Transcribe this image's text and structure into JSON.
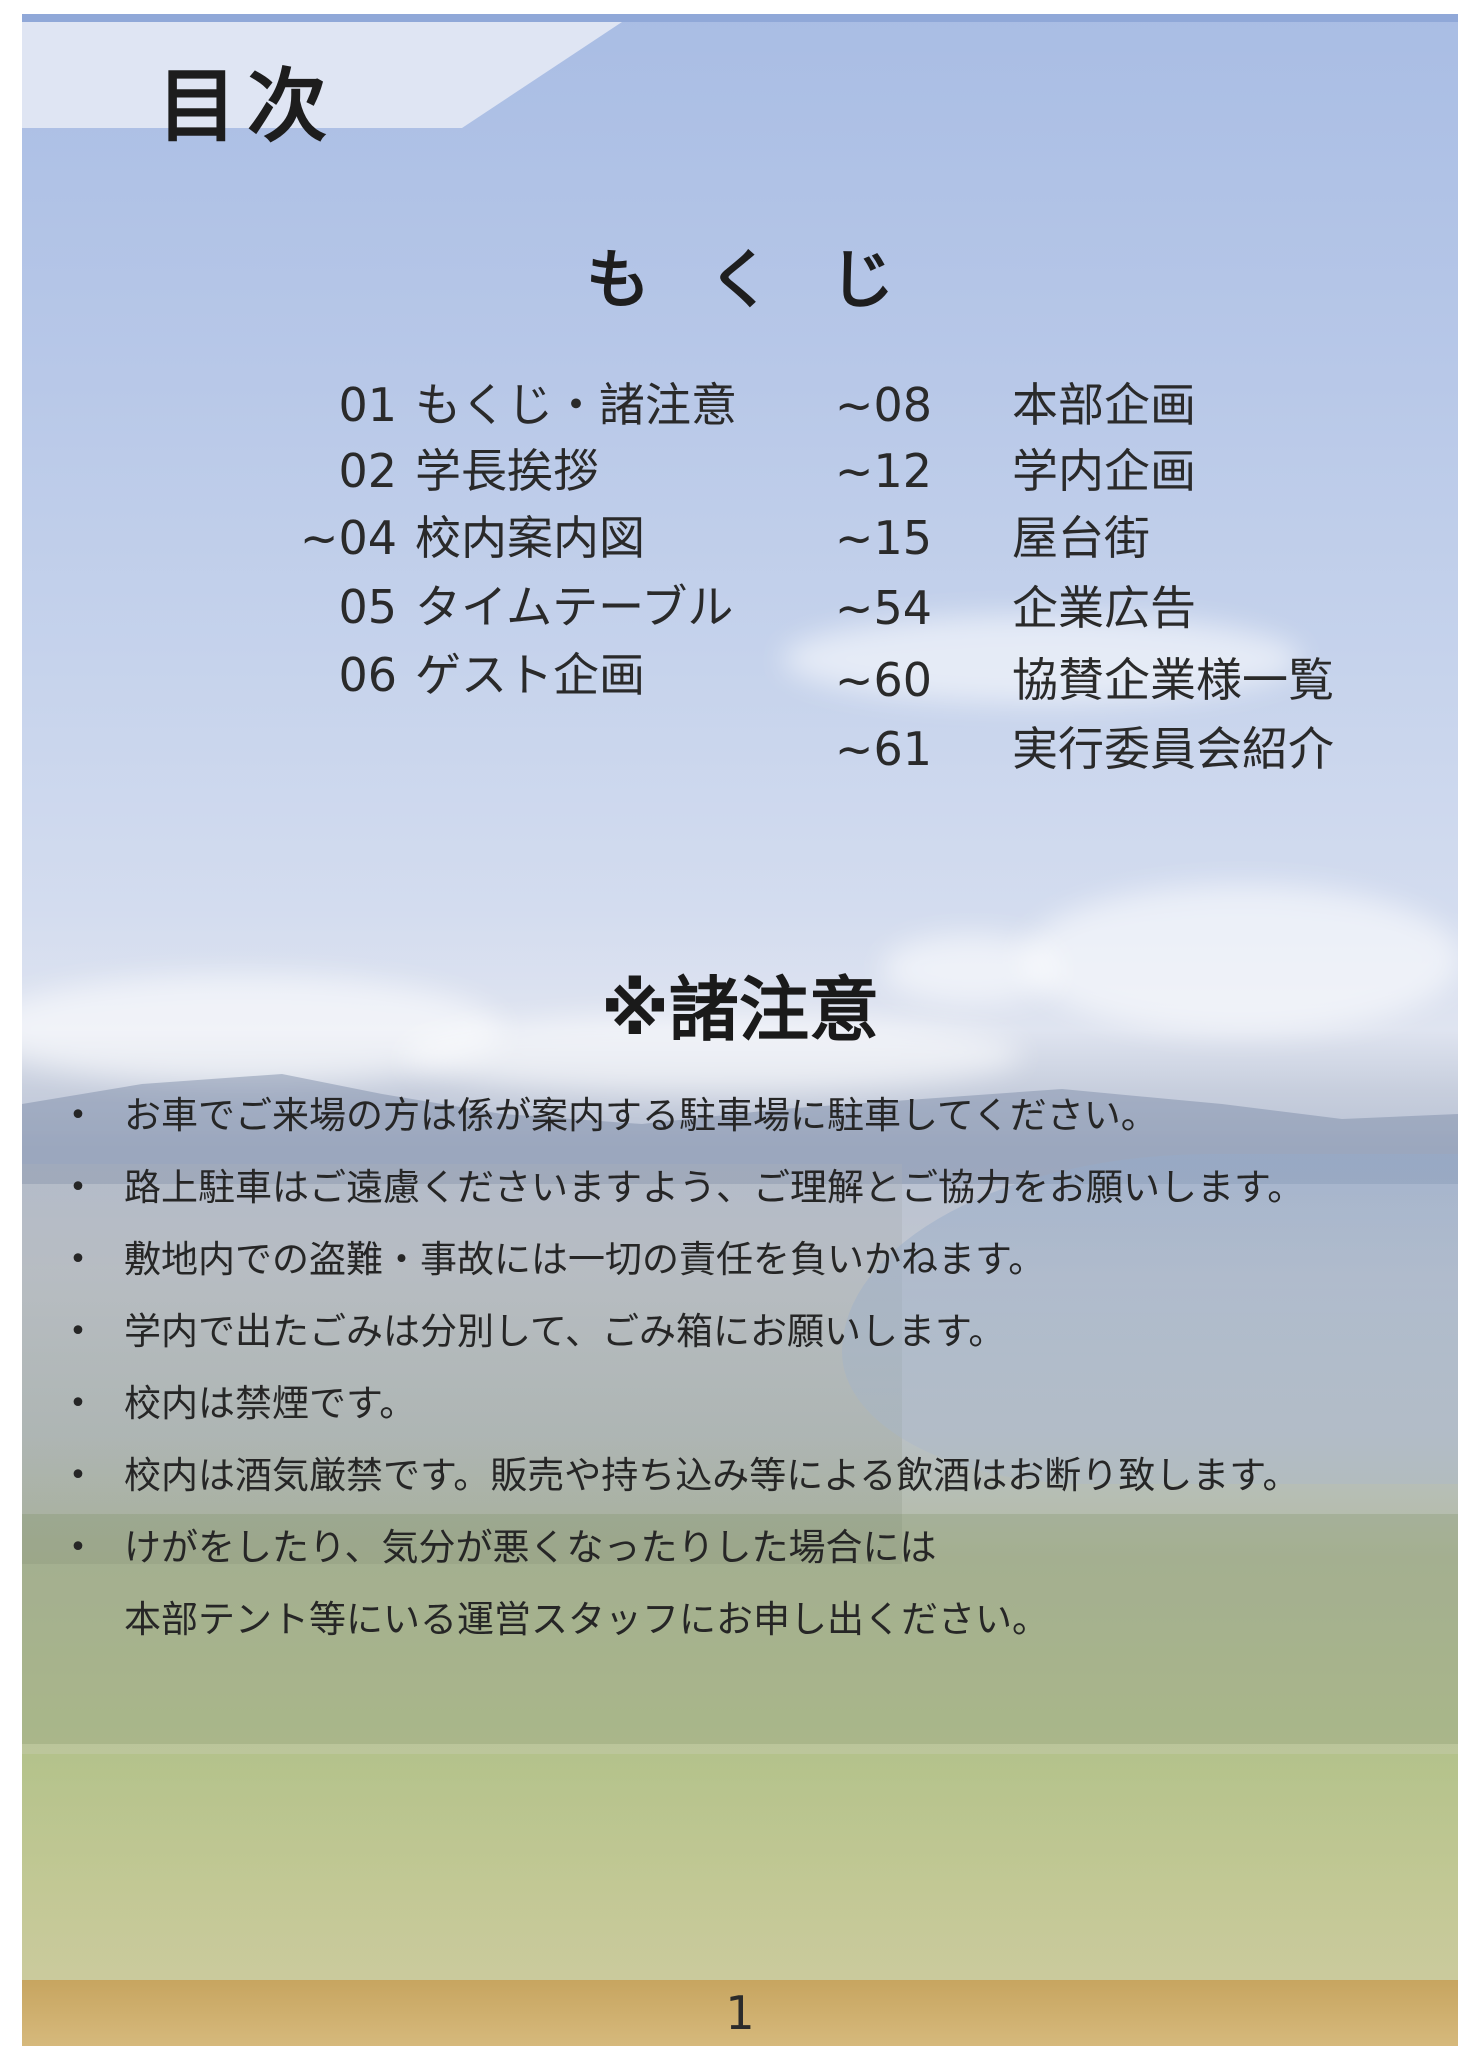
{
  "header": {
    "title": "目次"
  },
  "toc": {
    "heading": "もくじ",
    "left": [
      {
        "num": "01",
        "title": "もくじ・諸注意"
      },
      {
        "num": "02",
        "title": "学長挨拶"
      },
      {
        "num": "~04",
        "title": " 校内案内図"
      },
      {
        "num": "05",
        "title": "タイムテーブル"
      },
      {
        "num": "06",
        "title": "ゲスト企画"
      }
    ],
    "right": [
      {
        "num": "~08",
        "title": "本部企画"
      },
      {
        "num": "~12",
        "title": "学内企画"
      },
      {
        "num": "~15",
        "title": "屋台街"
      },
      {
        "num": "~54",
        "title": "企業広告"
      },
      {
        "num": "~60",
        "title": "協賛企業様一覧"
      },
      {
        "num": "~61",
        "title": "実行委員会紹介"
      }
    ]
  },
  "notices": {
    "heading": "※諸注意",
    "bullet": "•",
    "items": [
      "お車でご来場の方は係が案内する駐車場に駐車してください。",
      "路上駐車はご遠慮くださいますよう、ご理解とご協力をお願いします。",
      "敷地内での盗難・事故には一切の責任を負いかねます。",
      "学内で出たごみは分別して、ごみ箱にお願いします。",
      "校内は禁煙です。",
      "校内は酒気厳禁です。販売や持ち込み等による飲酒はお断り致します。",
      "けがをしたり、気分が悪くなったりした場合には"
    ],
    "last_item_continuation": "本部テント等にいる運営スタッフにお申し出ください。"
  },
  "footer": {
    "page_number": "1"
  }
}
